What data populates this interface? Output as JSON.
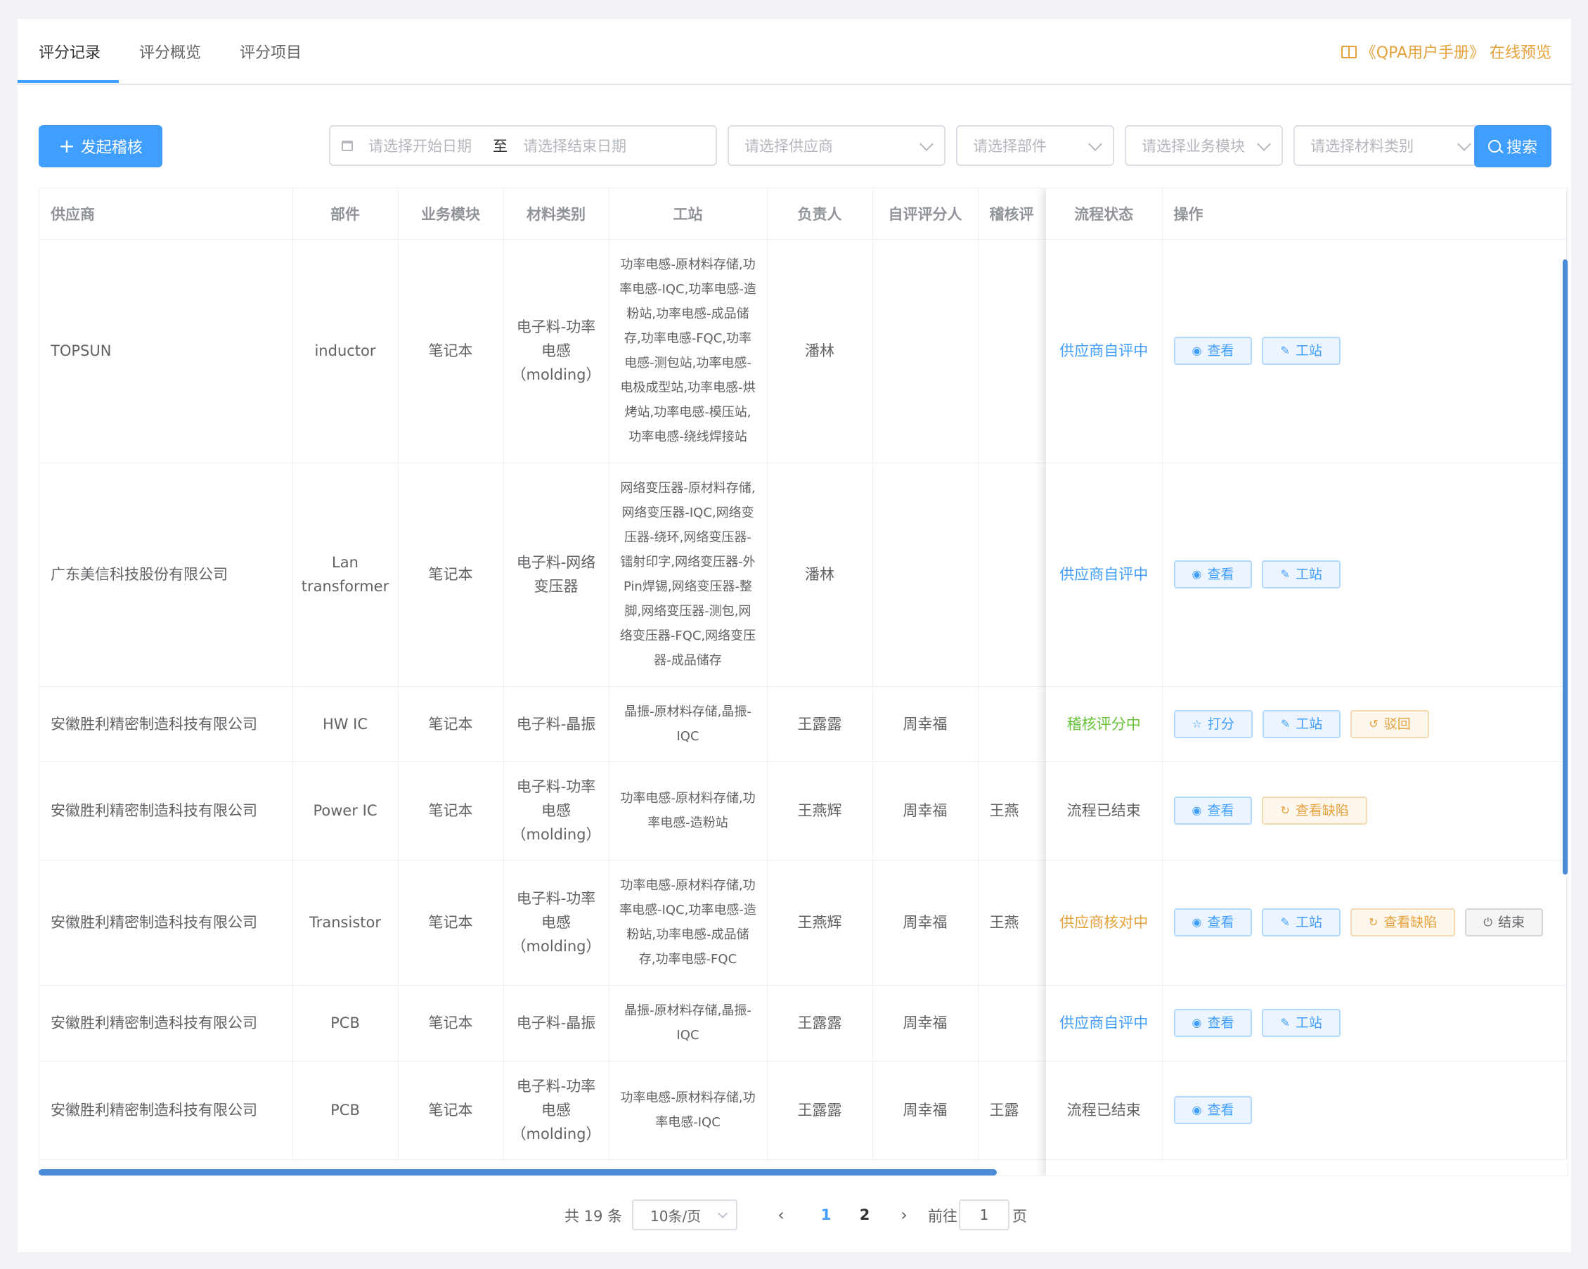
{
  "tabs": [
    {
      "label": "评分记录",
      "active": true
    },
    {
      "label": "评分概览",
      "active": false
    },
    {
      "label": "评分项目",
      "active": false
    }
  ],
  "manual_link": "《QPA用户手册》 在线预览",
  "toolbar": {
    "create_label": "发起稽核",
    "start_date_placeholder": "请选择开始日期",
    "date_separator": "至",
    "end_date_placeholder": "请选择结束日期",
    "supplier_placeholder": "请选择供应商",
    "part_placeholder": "请选择部件",
    "module_placeholder": "请选择业务模块",
    "material_placeholder": "请选择材料类别",
    "search_label": "搜索"
  },
  "table": {
    "headers": {
      "supplier": "供应商",
      "part": "部件",
      "module": "业务模块",
      "material": "材料类别",
      "station": "工站",
      "owner": "负责人",
      "self_scorer": "自评评分人",
      "auditor": "稽核评",
      "status": "流程状态",
      "ops": "操作"
    },
    "rows": [
      {
        "supplier": "TOPSUN",
        "part": "inductor",
        "module": "笔记本",
        "material": "电子料-功率电感（molding）",
        "station": "功率电感-原材料存储,功率电感-IQC,功率电感-造粉站,功率电感-成品储存,功率电感-FQC,功率电感-测包站,功率电感-电极成型站,功率电感-烘烤站,功率电感-模压站,功率电感-绕线焊接站",
        "owner": "潘林",
        "self_scorer": "",
        "auditor": "",
        "status": "供应商自评中",
        "status_color": "blue",
        "actions": [
          "查看",
          "工站"
        ]
      },
      {
        "supplier": "广东美信科技股份有限公司",
        "part": "Lan transformer",
        "module": "笔记本",
        "material": "电子料-网络变压器",
        "station": "网络变压器-原材料存储,网络变压器-IQC,网络变压器-绕环,网络变压器-镭射印字,网络变压器-外Pin焊锡,网络变压器-整脚,网络变压器-测包,网络变压器-FQC,网络变压器-成品储存",
        "owner": "潘林",
        "self_scorer": "",
        "auditor": "",
        "status": "供应商自评中",
        "status_color": "blue",
        "actions": [
          "查看",
          "工站"
        ]
      },
      {
        "supplier": "安徽胜利精密制造科技有限公司",
        "part": "HW IC",
        "module": "笔记本",
        "material": "电子料-晶振",
        "station": "晶振-原材料存储,晶振-IQC",
        "owner": "王露露",
        "self_scorer": "周幸福",
        "auditor": "",
        "status": "稽核评分中",
        "status_color": "green",
        "actions": [
          "打分",
          "工站",
          "驳回"
        ]
      },
      {
        "supplier": "安徽胜利精密制造科技有限公司",
        "part": "Power IC",
        "module": "笔记本",
        "material": "电子料-功率电感（molding）",
        "station": "功率电感-原材料存储,功率电感-造粉站",
        "owner": "王燕辉",
        "self_scorer": "周幸福",
        "auditor": "王燕",
        "status": "流程已结束",
        "status_color": "gray",
        "actions": [
          "查看",
          "查看缺陷"
        ]
      },
      {
        "supplier": "安徽胜利精密制造科技有限公司",
        "part": "Transistor",
        "module": "笔记本",
        "material": "电子料-功率电感（molding）",
        "station": "功率电感-原材料存储,功率电感-IQC,功率电感-造粉站,功率电感-成品储存,功率电感-FQC",
        "owner": "王燕辉",
        "self_scorer": "周幸福",
        "auditor": "王燕",
        "status": "供应商核对中",
        "status_color": "orange",
        "actions": [
          "查看",
          "工站",
          "查看缺陷",
          "结束"
        ]
      },
      {
        "supplier": "安徽胜利精密制造科技有限公司",
        "part": "PCB",
        "module": "笔记本",
        "material": "电子料-晶振",
        "station": "晶振-原材料存储,晶振-IQC",
        "owner": "王露露",
        "self_scorer": "周幸福",
        "auditor": "",
        "status": "供应商自评中",
        "status_color": "blue",
        "actions": [
          "查看",
          "工站"
        ]
      },
      {
        "supplier": "安徽胜利精密制造科技有限公司",
        "part": "PCB",
        "module": "笔记本",
        "material": "电子料-功率电感（molding）",
        "station": "功率电感-原材料存储,功率电感-IQC",
        "owner": "王露露",
        "self_scorer": "周幸福",
        "auditor": "王露",
        "status": "流程已结束",
        "status_color": "gray",
        "actions": [
          "查看"
        ]
      }
    ]
  },
  "pagination": {
    "total_text": "共 19 条",
    "page_size": "10条/页",
    "pages": [
      "1",
      "2"
    ],
    "current_page": "1",
    "goto_label": "前往",
    "goto_value": "1",
    "goto_suffix": "页"
  },
  "colors": {
    "primary": "#409eff",
    "success": "#67c23a",
    "warning": "#e6a23c"
  }
}
